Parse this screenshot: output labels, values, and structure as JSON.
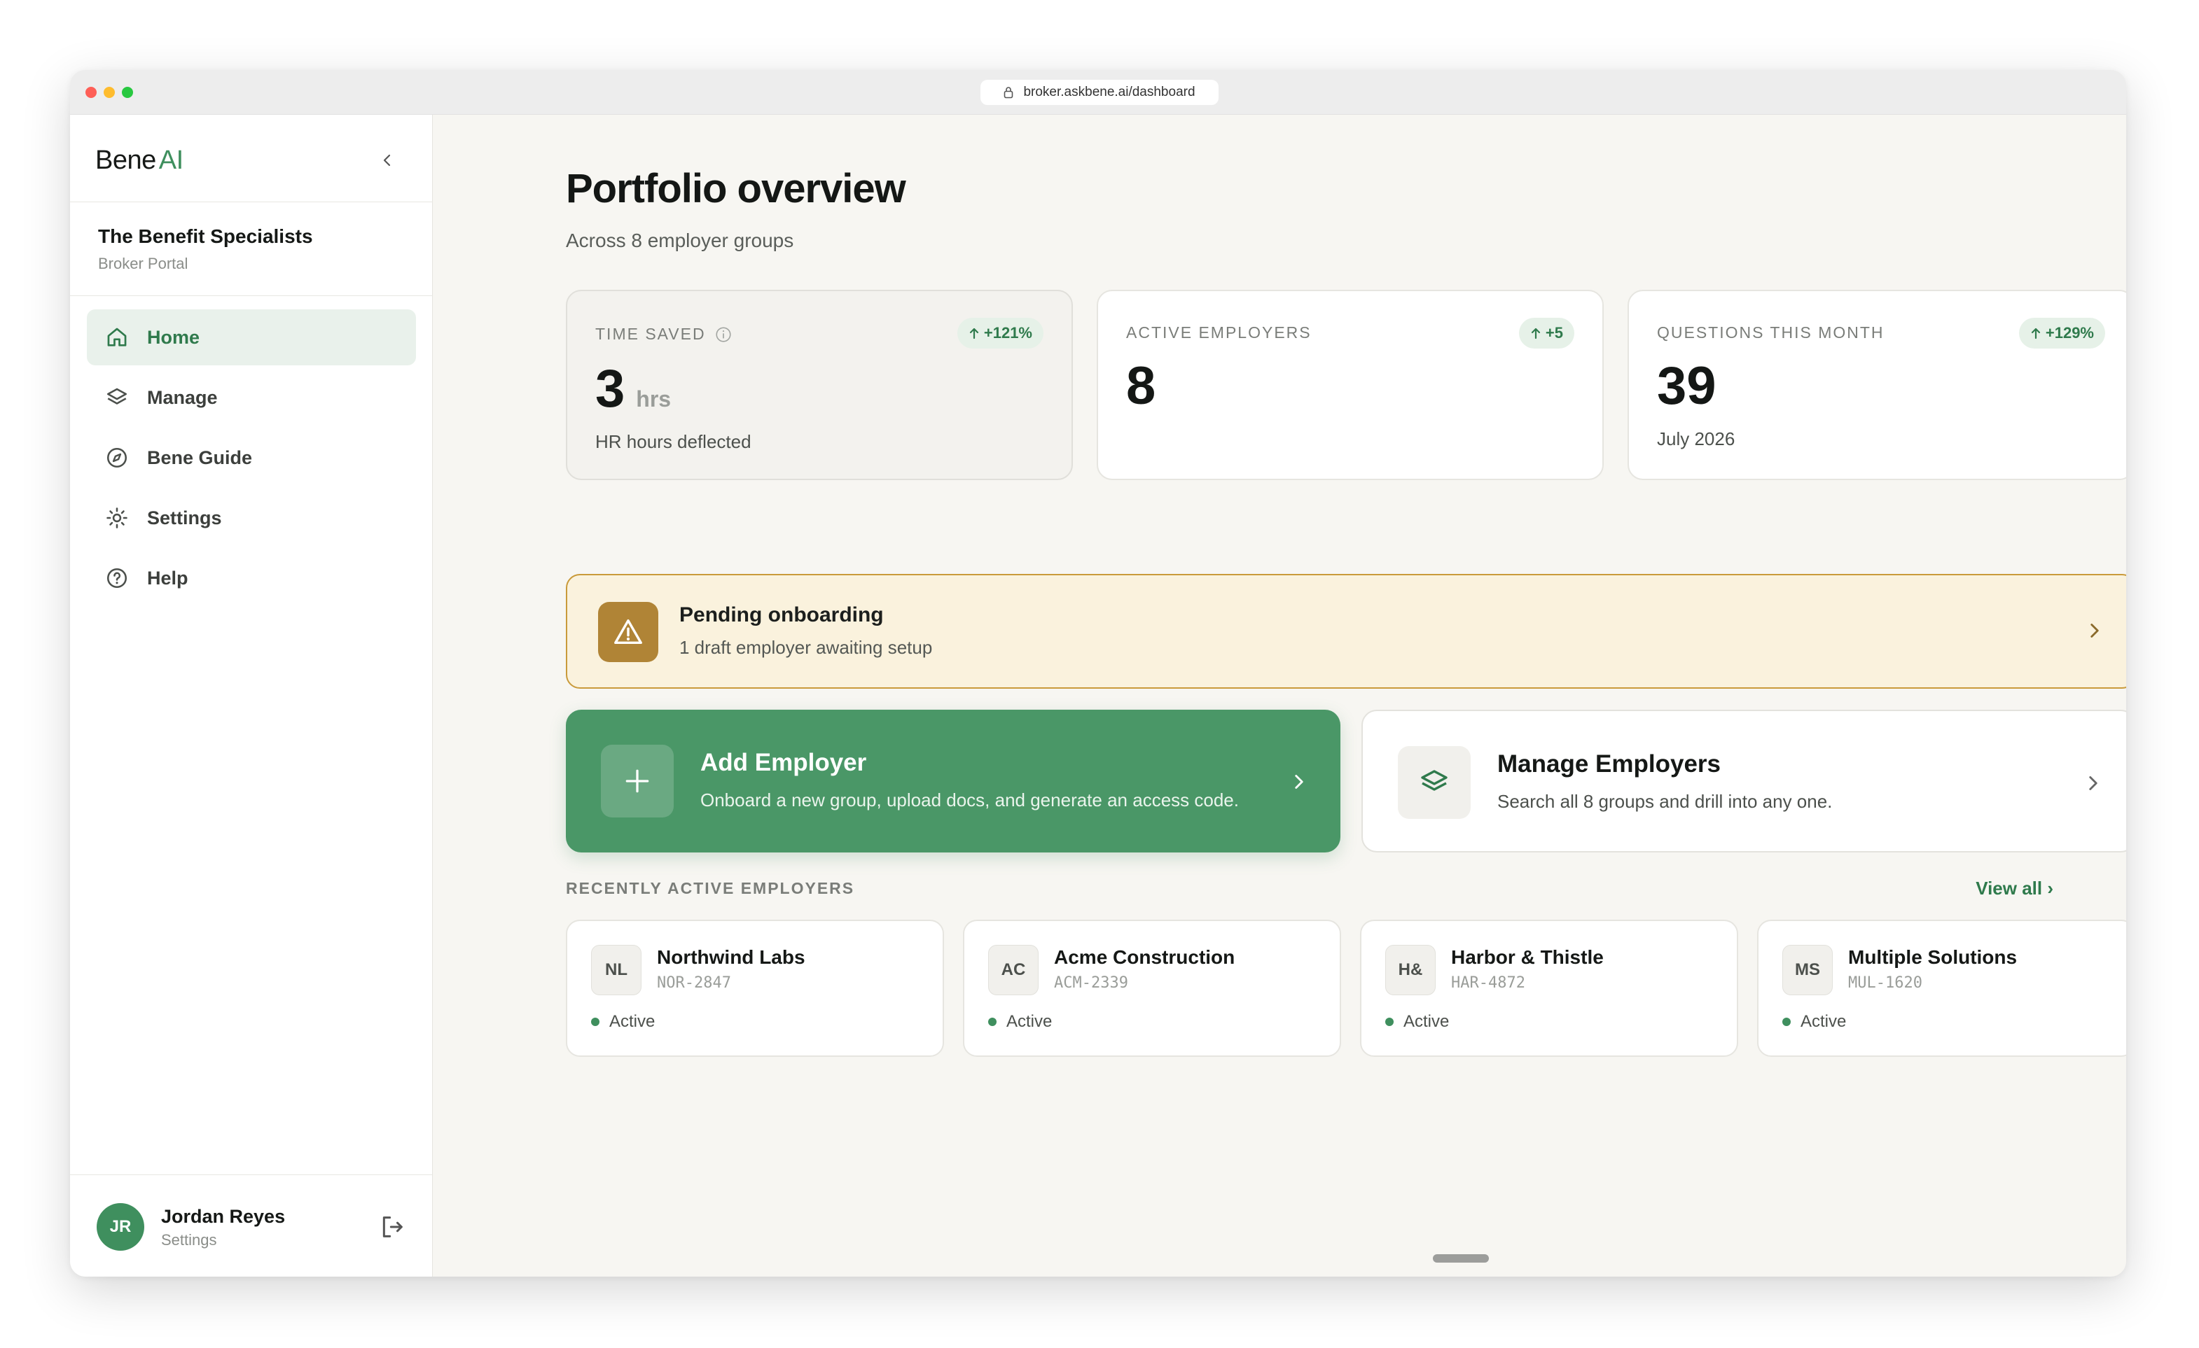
{
  "browser": {
    "url": "broker.askbene.ai/dashboard"
  },
  "sidebar": {
    "logo_main": "Bene",
    "logo_accent": "AI",
    "org_name": "The Benefit Specialists",
    "org_sub": "Broker Portal",
    "items": [
      {
        "label": "Home",
        "icon": "home-icon",
        "active": true
      },
      {
        "label": "Manage",
        "icon": "layers-icon",
        "active": false
      },
      {
        "label": "Bene Guide",
        "icon": "compass-icon",
        "active": false
      },
      {
        "label": "Settings",
        "icon": "sun-gear-icon",
        "active": false
      },
      {
        "label": "Help",
        "icon": "help-circle-icon",
        "active": false
      }
    ],
    "user": {
      "initials": "JR",
      "name": "Jordan Reyes",
      "sub": "Settings"
    }
  },
  "main": {
    "title": "Portfolio overview",
    "subtitle": "Across 8 employer groups",
    "stats": [
      {
        "label": "TIME SAVED",
        "delta": "+121%",
        "value": "3",
        "unit": "hrs",
        "note": "HR hours deflected"
      },
      {
        "label": "ACTIVE EMPLOYERS",
        "delta": "+5",
        "value": "8",
        "unit": "",
        "note": ""
      },
      {
        "label": "QUESTIONS THIS MONTH",
        "delta": "+129%",
        "value": "39",
        "unit": "",
        "note": "July 2026"
      }
    ],
    "banner": {
      "title": "Pending onboarding",
      "sub": "1 draft employer awaiting setup"
    },
    "actions": {
      "add": {
        "title": "Add Employer",
        "sub": "Onboard a new group, upload docs, and generate an access code."
      },
      "manage": {
        "title": "Manage Employers",
        "sub": "Search all 8 groups and drill into any one."
      }
    },
    "recent_label": "RECENTLY ACTIVE EMPLOYERS",
    "view_all": "View all ›",
    "employers": [
      {
        "initials": "NL",
        "name": "Northwind Labs",
        "code": "NOR-2847",
        "status": "Active"
      },
      {
        "initials": "AC",
        "name": "Acme Construction",
        "code": "ACM-2339",
        "status": "Active"
      },
      {
        "initials": "H&",
        "name": "Harbor & Thistle",
        "code": "HAR-4872",
        "status": "Active"
      },
      {
        "initials": "MS",
        "name": "Multiple Solutions",
        "code": "MUL-1620",
        "status": "Active"
      }
    ]
  },
  "colors": {
    "accent": "#3f8f5e",
    "accent_dark": "#2f7a4c",
    "warning": "#b08436",
    "warning_bg": "#faf2dd"
  }
}
